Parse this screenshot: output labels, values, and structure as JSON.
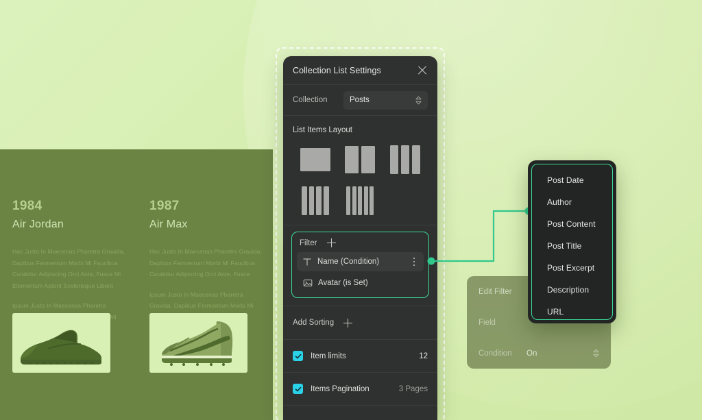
{
  "theme": {
    "bg_light": "#d4ecab",
    "bg_band_dark": "#6b8444",
    "panel_bg": "#2f3130",
    "accent_green": "#3ddb9a",
    "accent_cyan": "#2ad2e8",
    "text_primary": "#e4e5e3",
    "text_muted": "#9a9c99"
  },
  "left_showcase": {
    "columns": [
      {
        "year": "1984",
        "model": "Air Jordan",
        "paragraph_1": "Hac Justo In Maecenas Pharetra Gravida, Dapibus Fermentum Morbi Mi Faucibus Curabitur Adipiscing Orci Ante, Fusce Mi Elementum Aptent Scelerisque Libero",
        "paragraph_2": "Ipsum Justo In Maecenas Pharetra Gravida, Dapibus Fermentum Morbi Mi Faucibus",
        "image_alt": "running-shoe-photo"
      },
      {
        "year": "1987",
        "model": "Air Max",
        "paragraph_1": "Hac Justo In Maecenas Pharetra Gravida, Dapibus Fermentum Morbi Mi Faucibus Curabitur Adipiscing Orci Ante, Fusce",
        "paragraph_2": "Ipsum Justo In Maecenas Pharetra Gravida, Dapibus Fermentum Morbi Mi Faucibus",
        "image_alt": "soccer-cleat-photo"
      }
    ]
  },
  "settings_panel": {
    "title": "Collection List Settings",
    "close_icon": "close-icon",
    "collection": {
      "label": "Collection",
      "value": "Posts",
      "icon": "chevron-updown-icon"
    },
    "layout": {
      "title": "List Items Layout",
      "options": [
        {
          "name": "one-column",
          "columns": 1
        },
        {
          "name": "two-column",
          "columns": 2
        },
        {
          "name": "three-column",
          "columns": 3
        },
        {
          "name": "four-column",
          "columns": 4
        },
        {
          "name": "five-column",
          "columns": 5
        }
      ]
    },
    "filter": {
      "label": "Filter",
      "add_icon": "plus-icon",
      "items": [
        {
          "icon": "text-field-icon",
          "label": "Name (Condition)",
          "selected": true,
          "menu_icon": "kebab-menu-icon"
        },
        {
          "icon": "image-field-icon",
          "label": "Avatar (is Set)",
          "selected": false
        }
      ]
    },
    "sorting": {
      "label": "Add Sorting",
      "add_icon": "plus-icon"
    },
    "item_limits": {
      "label": "Item limits",
      "value": "12",
      "checked": true
    },
    "items_pagination": {
      "label": "Items Pagination",
      "value": "3 Pages",
      "checked": true
    }
  },
  "edit_filter_card": {
    "title": "Edit Filter",
    "field": {
      "label": "Field",
      "value": ""
    },
    "condition": {
      "label": "Condition",
      "value": "On",
      "icon": "chevron-updown-icon"
    }
  },
  "field_dropdown": {
    "options": [
      "Post Date",
      "Author",
      "Post Content",
      "Post Title",
      "Post Excerpt",
      "Description",
      "URL"
    ]
  }
}
